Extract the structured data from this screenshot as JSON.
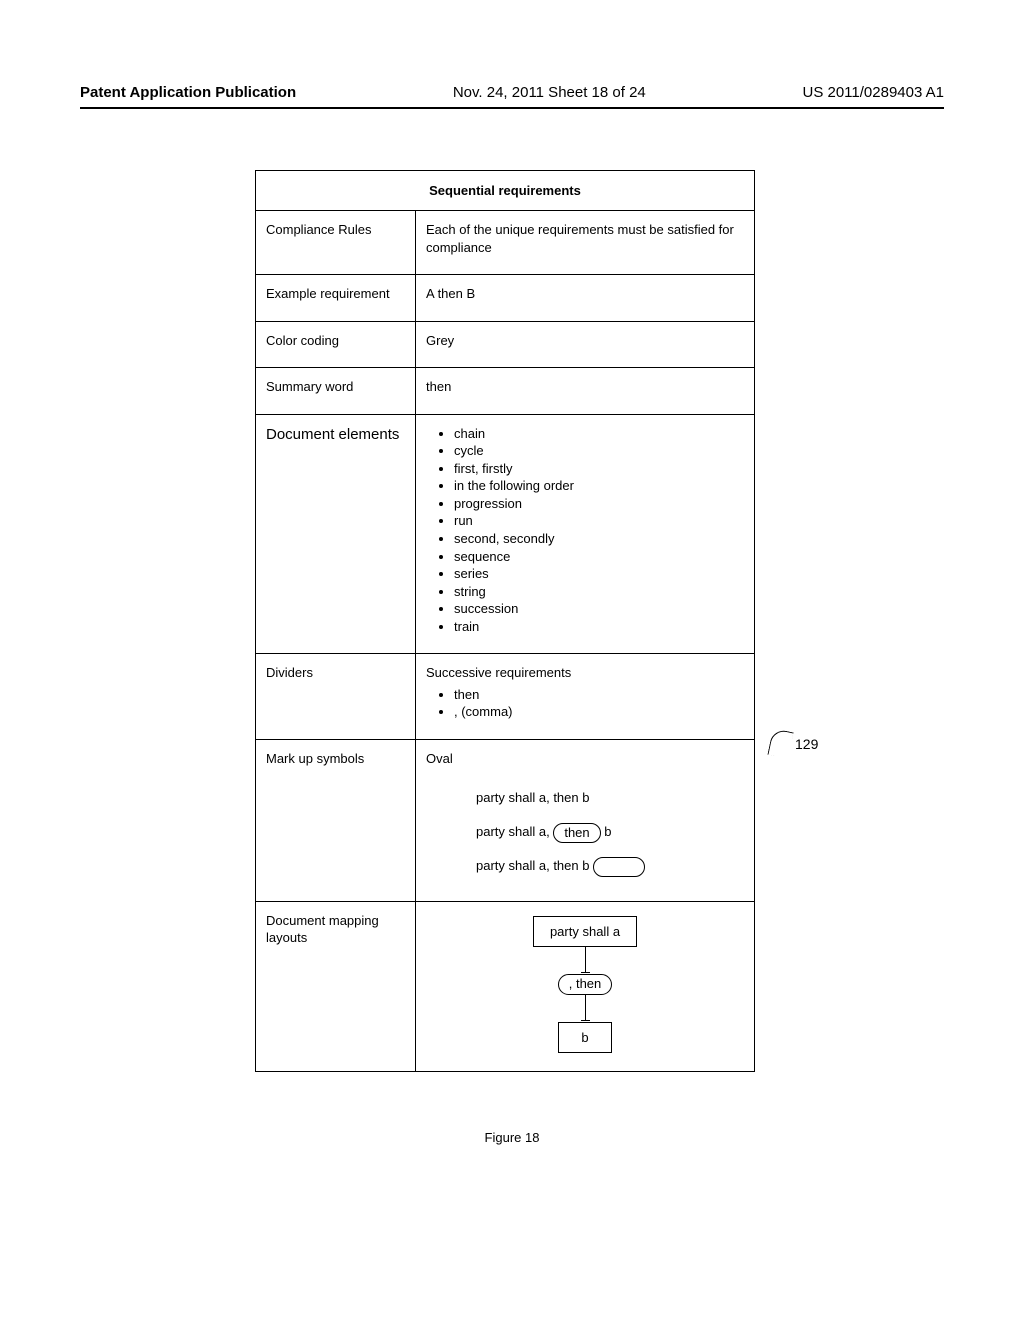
{
  "header": {
    "left": "Patent Application Publication",
    "mid": "Nov. 24, 2011  Sheet 18 of 24",
    "right": "US 2011/0289403 A1"
  },
  "table": {
    "title": "Sequential requirements",
    "rows": {
      "compliance": {
        "label": "Compliance Rules",
        "value": "Each of the unique requirements must be satisfied for compliance"
      },
      "example": {
        "label": "Example requirement",
        "value": "A then B"
      },
      "color": {
        "label": "Color coding",
        "value": "Grey"
      },
      "summary": {
        "label": "Summary word",
        "value": "then"
      },
      "docelems": {
        "label": "Document elements",
        "items": [
          "chain",
          "cycle",
          "first, firstly",
          "in the following order",
          "progression",
          "run",
          "second, secondly",
          "sequence",
          "series",
          "string",
          "succession",
          "train"
        ]
      },
      "dividers": {
        "label": "Dividers",
        "lead": "Successive requirements",
        "items": [
          "then",
          ", (comma)"
        ]
      },
      "markup": {
        "label": "Mark up symbols",
        "shape": "Oval",
        "line1_pre": "party shall a, then b",
        "line2_pre": "party shall a, ",
        "line2_oval": "then",
        "line2_post": " b",
        "line3_pre": "party shall a, then b "
      },
      "mapping": {
        "label": "Document  mapping layouts",
        "top": "party shall a",
        "mid": ", then",
        "bot": "b"
      }
    }
  },
  "ref": "129",
  "figure_caption": "Figure 18"
}
